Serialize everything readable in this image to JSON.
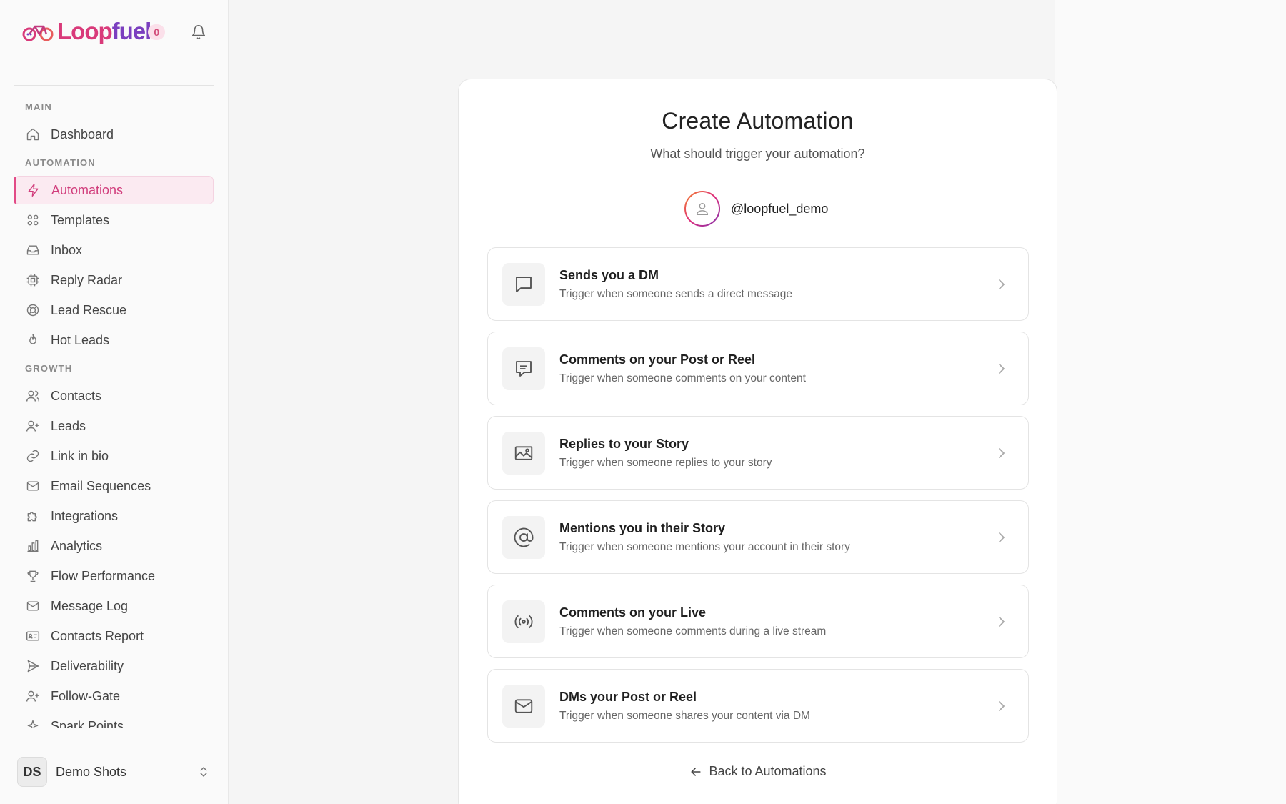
{
  "app": {
    "brand_name_part1": "Loop",
    "brand_name_part2": "fuel",
    "notification_count": "0",
    "brand_color": "#d93a7a",
    "accent_color": "#e24a86"
  },
  "sidebar": {
    "sections": {
      "main": "MAIN",
      "automation": "AUTOMATION",
      "growth": "GROWTH"
    },
    "items": {
      "dashboard": "Dashboard",
      "automations": "Automations",
      "templates": "Templates",
      "inbox": "Inbox",
      "reply_radar": "Reply Radar",
      "lead_rescue": "Lead Rescue",
      "hot_leads": "Hot Leads",
      "contacts": "Contacts",
      "leads": "Leads",
      "link_in_bio": "Link in bio",
      "email_sequences": "Email Sequences",
      "integrations": "Integrations",
      "analytics": "Analytics",
      "flow_performance": "Flow Performance",
      "message_log": "Message Log",
      "contacts_report": "Contacts Report",
      "deliverability": "Deliverability",
      "follow_gate": "Follow-Gate",
      "spark_points": "Spark Points"
    },
    "active_item": "automations",
    "account": {
      "initials": "DS",
      "name": "Demo Shots"
    }
  },
  "main": {
    "title": "Create Automation",
    "subtitle": "What should trigger your automation?",
    "profile_handle": "@loopfuel_demo",
    "triggers": [
      {
        "title": "Sends you a DM",
        "description": "Trigger when someone sends a direct message",
        "icon": "message-bubble-icon"
      },
      {
        "title": "Comments on your Post or Reel",
        "description": "Trigger when someone comments on your content",
        "icon": "comment-icon"
      },
      {
        "title": "Replies to your Story",
        "description": "Trigger when someone replies to your story",
        "icon": "image-icon"
      },
      {
        "title": "Mentions you in their Story",
        "description": "Trigger when someone mentions your account in their story",
        "icon": "at-sign-icon"
      },
      {
        "title": "Comments on your Live",
        "description": "Trigger when someone comments during a live stream",
        "icon": "broadcast-icon"
      },
      {
        "title": "DMs your Post or Reel",
        "description": "Trigger when someone shares your content via DM",
        "icon": "mail-icon"
      }
    ],
    "back_link": "Back to Automations"
  }
}
